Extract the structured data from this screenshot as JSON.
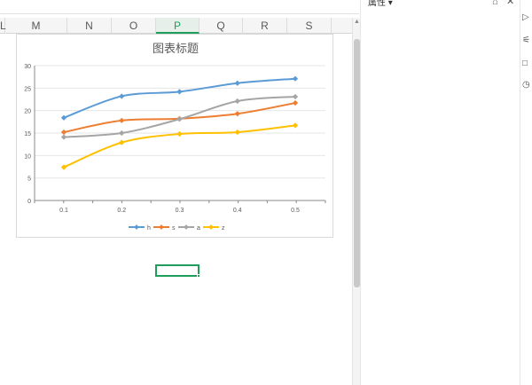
{
  "columns": [
    "L",
    "M",
    "N",
    "O",
    "P",
    "Q",
    "R",
    "S"
  ],
  "active_column": "P",
  "panel": {
    "title": "属性",
    "title_suffix": "▾"
  },
  "chart_data": {
    "type": "line",
    "title": "图表标题",
    "x": [
      "0.1",
      "0.2",
      "0.3",
      "0.4",
      "0.5"
    ],
    "ylim": [
      0,
      30
    ],
    "yticks": [
      0,
      5,
      10,
      15,
      20,
      25,
      30
    ],
    "smooth": true,
    "legend": "bottom",
    "series": [
      {
        "name": "h",
        "color": "#5b9bd5",
        "values": [
          18.4,
          23.2,
          24.2,
          26.1,
          27.1
        ]
      },
      {
        "name": "s",
        "color": "#ed7d31",
        "values": [
          15.2,
          17.8,
          18.2,
          19.3,
          21.7
        ]
      },
      {
        "name": "a",
        "color": "#a5a5a5",
        "values": [
          14.1,
          15.0,
          18.1,
          22.1,
          23.1
        ]
      },
      {
        "name": "z",
        "color": "#ffc000",
        "values": [
          7.4,
          12.9,
          14.8,
          15.2,
          16.7
        ]
      }
    ]
  }
}
